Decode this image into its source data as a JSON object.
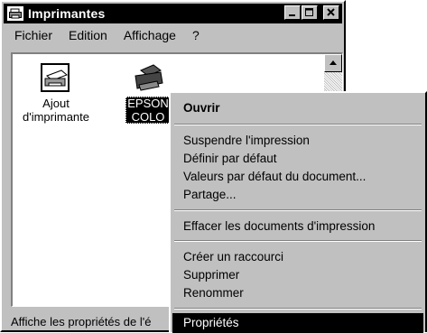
{
  "window": {
    "title": "Imprimantes",
    "menu": [
      "Fichier",
      "Edition",
      "Affichage",
      "?"
    ],
    "icons": [
      {
        "label_line1": "Ajout",
        "label_line2": "d'imprimante",
        "icon": "add-printer-icon"
      },
      {
        "label_line1": "EPSON",
        "label_line2": "COLO",
        "icon": "printer-icon"
      }
    ],
    "status": "Affiche les propriétés de l'é"
  },
  "context_menu": {
    "open": "Ouvrir",
    "pause": "Suspendre l'impression",
    "default": "Définir par défaut",
    "doc_defaults": "Valeurs par défaut du document...",
    "share": "Partage...",
    "purge": "Effacer les documents d'impression",
    "shortcut": "Créer un raccourci",
    "delete": "Supprimer",
    "rename": "Renommer",
    "properties": "Propriétés"
  }
}
